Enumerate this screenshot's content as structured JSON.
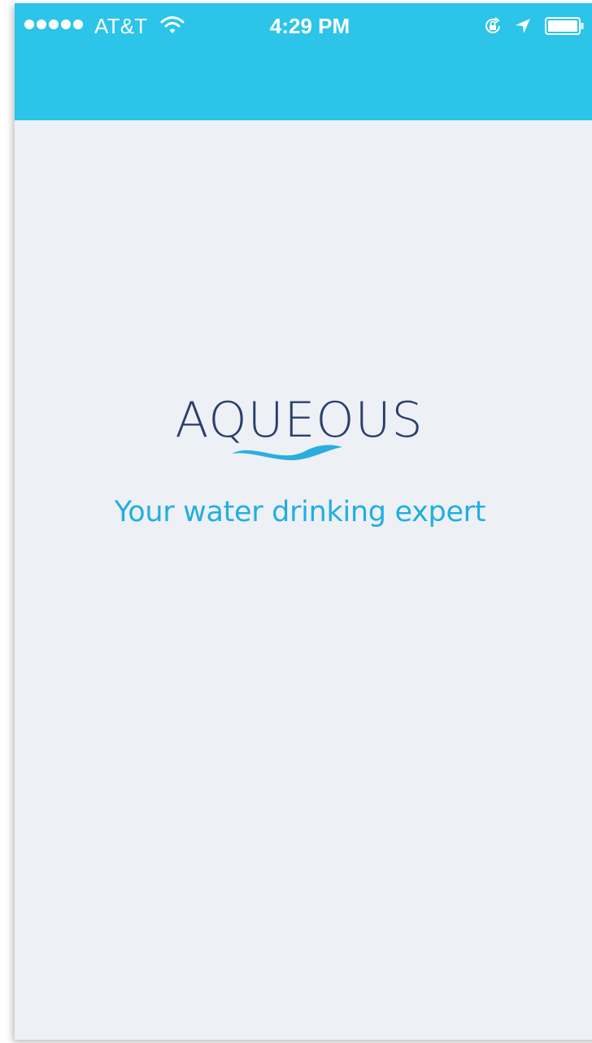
{
  "status_bar": {
    "carrier": "AT&T",
    "time": "4:29 PM",
    "signal_bars": 5,
    "icons": [
      "signal-dots-icon",
      "wifi-icon",
      "rotation-lock-icon",
      "location-arrow-icon",
      "battery-icon"
    ]
  },
  "brand": {
    "logo_text": "AQUEOUS",
    "tagline": "Your water drinking expert"
  },
  "colors": {
    "header": "#2cc4e8",
    "background": "#edf1f5",
    "logo": "#2a3f6b",
    "tagline": "#23aee0",
    "wave": "#2aaee0"
  }
}
